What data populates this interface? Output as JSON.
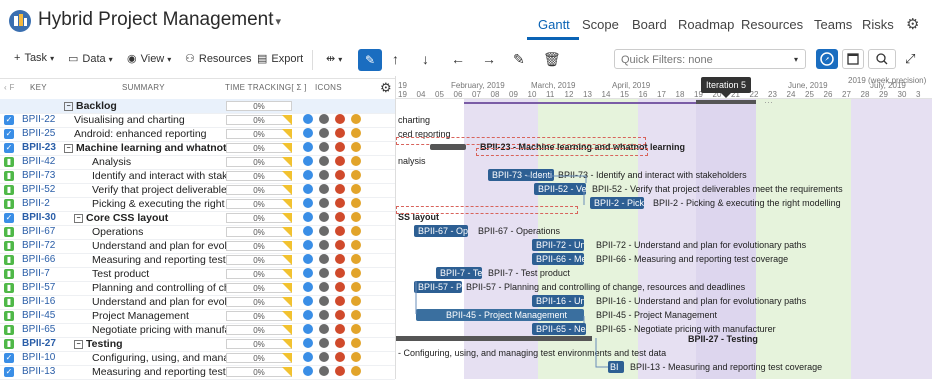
{
  "app": {
    "title": "Hybrid Project Management",
    "caret": "▾"
  },
  "nav": {
    "tabs": [
      "Gantt",
      "Scope",
      "Board",
      "Roadmap",
      "Resources",
      "Teams",
      "Risks"
    ],
    "active": "Gantt",
    "settings_icon": "gear-icon"
  },
  "toolbar": {
    "task": "Task",
    "data": "Data",
    "view": "View",
    "resources": "Resources",
    "export": "Export",
    "quick_filters": "Quick Filters: none"
  },
  "grid": {
    "headers": {
      "key": "KEY",
      "summary": "SUMMARY",
      "time_tracking": "TIME TRACKING[ Σ ]",
      "icons": "ICONS"
    },
    "rows": [
      {
        "key": "",
        "summary": "Backlog",
        "tt": "0%",
        "type": "group",
        "level": 0,
        "toggle": "−"
      },
      {
        "key": "BPII-22",
        "summary": "Visualising and charting",
        "tt": "0%",
        "type": "task",
        "level": 1
      },
      {
        "key": "BPII-25",
        "summary": "Android: enhanced reporting",
        "tt": "0%",
        "type": "task",
        "level": 1
      },
      {
        "key": "BPII-23",
        "summary": "Machine learning and whatnot lea",
        "tt": "0%",
        "type": "task",
        "level": 0,
        "bold": true,
        "toggle": "−"
      },
      {
        "key": "BPII-42",
        "summary": "Analysis",
        "tt": "0%",
        "type": "story",
        "level": 2
      },
      {
        "key": "BPII-73",
        "summary": "Identify and interact with stakehol",
        "tt": "0%",
        "type": "story",
        "level": 2
      },
      {
        "key": "BPII-52",
        "summary": "Verify that project deliverables me",
        "tt": "0%",
        "type": "story",
        "level": 2
      },
      {
        "key": "BPII-2",
        "summary": "Picking & executing the right mod",
        "tt": "0%",
        "type": "story",
        "level": 2
      },
      {
        "key": "BPII-30",
        "summary": "Core CSS layout",
        "tt": "0%",
        "type": "task",
        "level": 1,
        "bold": true,
        "toggle": "−"
      },
      {
        "key": "BPII-67",
        "summary": "Operations",
        "tt": "0%",
        "type": "story",
        "level": 2
      },
      {
        "key": "BPII-72",
        "summary": "Understand and plan for evolut",
        "tt": "0%",
        "type": "story",
        "level": 2
      },
      {
        "key": "BPII-66",
        "summary": "Measuring and reporting test c",
        "tt": "0%",
        "type": "story",
        "level": 2
      },
      {
        "key": "BPII-7",
        "summary": "Test product",
        "tt": "0%",
        "type": "story",
        "level": 2
      },
      {
        "key": "BPII-57",
        "summary": "Planning and controlling of cha",
        "tt": "0%",
        "type": "story",
        "level": 2
      },
      {
        "key": "BPII-16",
        "summary": "Understand and plan for evolut",
        "tt": "0%",
        "type": "story",
        "level": 2
      },
      {
        "key": "BPII-45",
        "summary": "Project Management",
        "tt": "0%",
        "type": "story",
        "level": 2
      },
      {
        "key": "BPII-65",
        "summary": "Negotiate pricing with manufac",
        "tt": "0%",
        "type": "story",
        "level": 2
      },
      {
        "key": "BPII-27",
        "summary": "Testing",
        "tt": "0%",
        "type": "story",
        "level": 1,
        "bold": true,
        "toggle": "−"
      },
      {
        "key": "BPII-10",
        "summary": "Configuring, using, and manag",
        "tt": "0%",
        "type": "task",
        "level": 2
      },
      {
        "key": "BPII-13",
        "summary": "Measuring and reporting test c",
        "tt": "0%",
        "type": "task",
        "level": 2
      }
    ]
  },
  "gantt": {
    "months": [
      "February, 2019",
      "March, 2019",
      "April, 2019",
      "June, 2019",
      "July, 2019"
    ],
    "precision": "2019 (week precision)",
    "weeks": [
      "19",
      "04",
      "05",
      "06",
      "07",
      "08",
      "09",
      "10",
      "11",
      "12",
      "13",
      "14",
      "15",
      "16",
      "17",
      "18",
      "19",
      "20",
      "21",
      "22",
      "23",
      "24",
      "25",
      "26",
      "27",
      "28",
      "29",
      "30",
      "3"
    ],
    "tooltip": "Iteration 5",
    "labels": {
      "r1": "charting",
      "r2": "ced reporting",
      "r3": "BPII-23 - Machine learning and whatnot learning",
      "r4": "nalysis",
      "r5_bar": "BPII-73 - Identi",
      "r5": "BPII-73 - Identify and interact with stakeholders",
      "r6_bar": "BPII-52 - Verify",
      "r6": "BPII-52 - Verify that project deliverables meet the requirements",
      "r7_bar": "BPII-2 - Picking",
      "r7": "BPII-2 - Picking & executing the right modelling",
      "r8": "SS layout",
      "r9_bar": "BPII-67 - Oper",
      "r9": "BPII-67 - Operations",
      "r10_bar": "BPII-72 - Unde",
      "r10": "BPII-72 - Understand and plan for evolutionary paths",
      "r11_bar": "BPII-66 - Meas",
      "r11": "BPII-66 - Measuring and reporting test coverage",
      "r12_bar": "BPII-7 - Te",
      "r12": "BPII-7 - Test product",
      "r13_bar": "BPII-57 - Plann",
      "r13": "BPII-57 - Planning and controlling of change, resources and deadlines",
      "r14_bar": "BPII-16 - Unde",
      "r14": "BPII-16 - Understand and plan for evolutionary paths",
      "r15_bar": "BPII-45 - Project Management",
      "r15": "BPII-45 - Project Management",
      "r16_bar": "BPII-65 - Nego",
      "r16": "BPII-65 - Negotiate pricing with manufacturer",
      "r17": "BPII-27 - Testing",
      "r18": "- Configuring, using, and managing test environments and test data",
      "r19_bar": "BI",
      "r19": "BPII-13 - Measuring and reporting test coverage"
    }
  },
  "colors": {
    "accent": "#0a63b5",
    "purple_band": "#e6e0f2",
    "green_band": "#e6f3dc",
    "bar": "#2d5f93"
  }
}
